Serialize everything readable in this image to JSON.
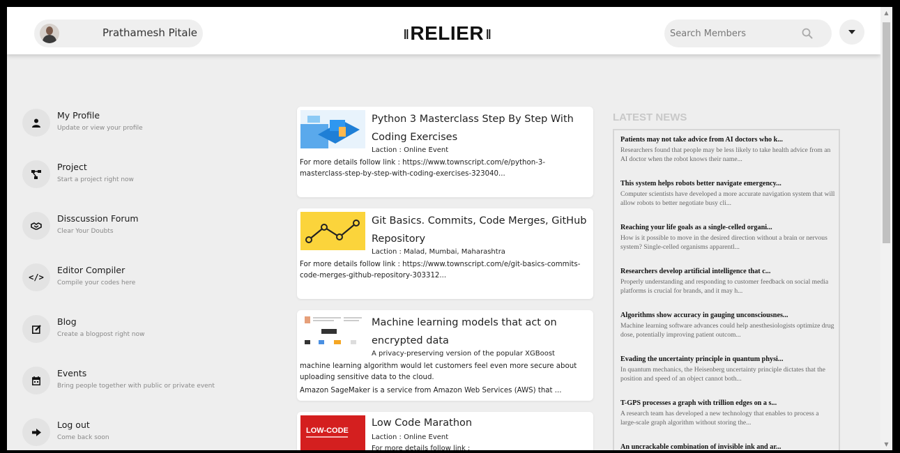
{
  "header": {
    "user_name": "Prathamesh Pitale",
    "logo_text": "RELIER",
    "search_placeholder": "Search Members"
  },
  "sidebar": {
    "items": [
      {
        "title": "My Profile",
        "subtitle": "Update or view your profile",
        "icon": "user-icon"
      },
      {
        "title": "Project",
        "subtitle": "Start a project right now",
        "icon": "project-diagram-icon"
      },
      {
        "title": "Disscussion Forum",
        "subtitle": "Clear Your Doubts",
        "icon": "handshake-icon"
      },
      {
        "title": "Editor Compiler",
        "subtitle": "Compile your codes here",
        "icon": "code-icon"
      },
      {
        "title": "Blog",
        "subtitle": "Create a blogpost right now",
        "icon": "edit-icon"
      },
      {
        "title": "Events",
        "subtitle": "Bring people together with public or private event",
        "icon": "calendar-icon"
      },
      {
        "title": "Log out",
        "subtitle": "Come back soon",
        "icon": "sign-out-icon"
      }
    ]
  },
  "events": [
    {
      "title": "Python 3 Masterclass Step By Step With Coding Exercises",
      "location": "Laction : Online Event",
      "details": "For more details follow link : https://www.townscript.com/e/python-3-masterclass-step-by-step-with-coding-exercises-323040..."
    },
    {
      "title": "Git Basics. Commits, Code Merges, GitHub Repository",
      "location": "Laction : Malad, Mumbai, Maharashtra",
      "details": "For more details follow link : https://www.townscript.com/e/git-basics-commits-code-merges-github-repository-303312..."
    },
    {
      "title": "Machine learning models that act on encrypted data",
      "location": "A privacy-preserving version of the popular XGBoost",
      "details": "machine learning algorithm would let customers feel even more secure about uploading sensitive data to the cloud.",
      "details2": "Amazon SageMaker is a service from Amazon Web Services (AWS) that ..."
    },
    {
      "title": "Low Code Marathon",
      "location": "Laction : Online Event",
      "details": "For more details follow link :",
      "thumb_text": "LOW-CODE"
    }
  ],
  "news": {
    "heading": "LATEST NEWS",
    "items": [
      {
        "title": "Patients may not take advice from AI doctors who k...",
        "desc": "Researchers found that people may be less likely to take health advice from an AI doctor when the robot knows their name..."
      },
      {
        "title": "This system helps robots better navigate emergency...",
        "desc": "Computer scientists have developed a more accurate navigation system that will allow robots to better negotiate busy cli..."
      },
      {
        "title": "Reaching your life goals as a single-celled organi...",
        "desc": "How is it possible to move in the desired direction without a brain or nervous system? Single-celled organisms apparentl..."
      },
      {
        "title": "Researchers develop artificial intelligence that c...",
        "desc": "Properly understanding and responding to customer feedback on social media platforms is crucial for brands, and it may h..."
      },
      {
        "title": "Algorithms show accuracy in gauging unconsciousnes...",
        "desc": "Machine learning software advances could help anesthesiologists optimize drug dose, potentially improving patient outcom..."
      },
      {
        "title": "Evading the uncertainty principle in quantum physi...",
        "desc": "In quantum mechanics, the Heisenberg uncertainty principle dictates that the position and speed of an object cannot both..."
      },
      {
        "title": "T-GPS processes a graph with trillion edges on a s...",
        "desc": "A research team has developed a new technology that enables to process a large-scale graph algorithm without storing the..."
      },
      {
        "title": "An uncrackable combination of invisible ink and ar...",
        "desc": ""
      }
    ]
  }
}
